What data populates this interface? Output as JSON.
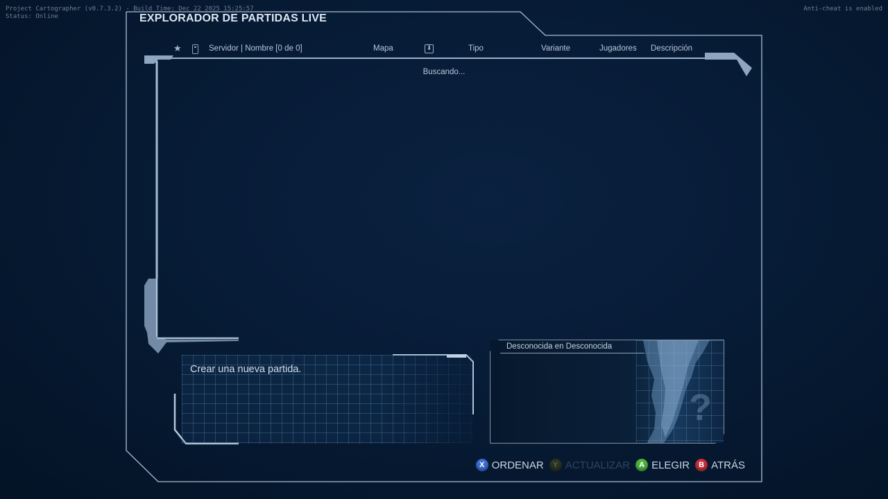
{
  "debug": {
    "left_line1": "Project Cartographer (v0.7.3.2) - Build Time: Dec 22 2025 15:25:57",
    "left_line2": "Status: Online",
    "right": "Anti-cheat is enabled"
  },
  "window": {
    "title": "EXPLORADOR DE PARTIDAS LIVE"
  },
  "table": {
    "columns": {
      "server_name": "Servidor | Nombre [0 de 0]",
      "map": "Mapa",
      "type": "Tipo",
      "variant": "Variante",
      "players": "Jugadores",
      "description": "Descripción"
    },
    "status": "Buscando...",
    "rows": []
  },
  "create": {
    "label": "Crear una nueva partida."
  },
  "preview": {
    "caption": "Desconocida en Desconocida",
    "placeholder": "?"
  },
  "buttons": [
    {
      "glyph": "X",
      "label": "ORDENAR",
      "color": "#3a6fd0",
      "enabled": true
    },
    {
      "glyph": "Y",
      "label": "ACTUALIZAR",
      "color": "#6b6a26",
      "enabled": false
    },
    {
      "glyph": "A",
      "label": "ELEGIR",
      "color": "#4fb43c",
      "enabled": true
    },
    {
      "glyph": "B",
      "label": "ATRÁS",
      "color": "#c8303a",
      "enabled": true
    }
  ],
  "icons": {
    "favorite": "star-icon",
    "server": "server-icon",
    "sort": "sort-down-icon",
    "unknown_map": "question-mark-icon"
  }
}
